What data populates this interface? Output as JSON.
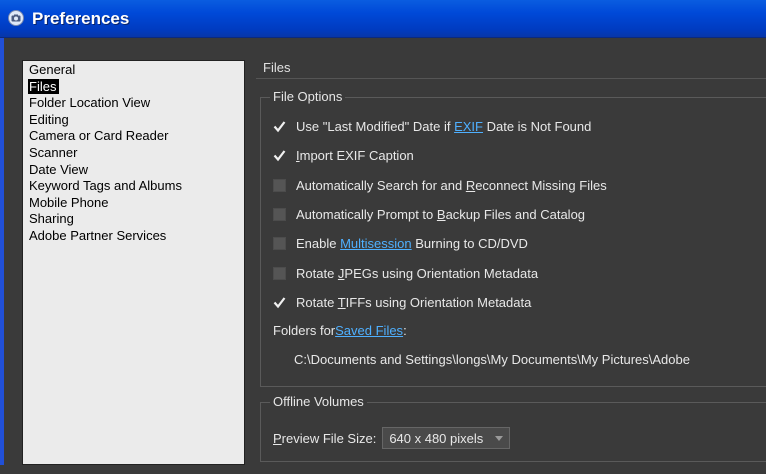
{
  "window": {
    "title": "Preferences"
  },
  "nav": {
    "items": [
      {
        "label": "General",
        "selected": false
      },
      {
        "label": "Files",
        "selected": true
      },
      {
        "label": "Folder Location View",
        "selected": false
      },
      {
        "label": "Editing",
        "selected": false
      },
      {
        "label": "Camera or Card Reader",
        "selected": false
      },
      {
        "label": "Scanner",
        "selected": false
      },
      {
        "label": "Date View",
        "selected": false
      },
      {
        "label": "Keyword Tags and Albums",
        "selected": false
      },
      {
        "label": "Mobile Phone",
        "selected": false
      },
      {
        "label": "Sharing",
        "selected": false
      },
      {
        "label": "Adobe Partner Services",
        "selected": false
      }
    ]
  },
  "section": {
    "title": "Files"
  },
  "file_options": {
    "legend": "File Options",
    "opt1": {
      "checked": true,
      "a": "Use \"Last Modified\" Date if ",
      "link": "EXIF",
      "b": " Date is Not Found"
    },
    "opt2": {
      "checked": true,
      "u": "I",
      "rest": "mport EXIF Caption"
    },
    "opt3": {
      "checked": false,
      "a": "Automatically Search for and ",
      "u": "R",
      "b": "econnect Missing Files"
    },
    "opt4": {
      "checked": false,
      "a": "Automatically Prompt to ",
      "u": "B",
      "b": "ackup Files and Catalog"
    },
    "opt5": {
      "checked": false,
      "a": "Enable ",
      "link": "Multisession",
      "b": " Burning to CD/DVD"
    },
    "opt6": {
      "checked": false,
      "a": "Rotate ",
      "u": "J",
      "b": "PEGs using Orientation Metadata"
    },
    "opt7": {
      "checked": true,
      "a": "Rotate ",
      "u": "T",
      "b": "IFFs using Orientation Metadata"
    },
    "saved_files": {
      "a": "Folders for ",
      "link": "Saved Files",
      "b": ":"
    },
    "saved_path": "C:\\Documents and Settings\\longs\\My Documents\\My Pictures\\Adobe"
  },
  "offline_volumes": {
    "legend": "Offline Volumes",
    "preview": {
      "u": "P",
      "rest": "review File Size:"
    },
    "preview_value": "640 x 480 pixels"
  },
  "colors": {
    "titlebar": "#0049d8",
    "panel": "#3a3a3a",
    "list_bg": "#ebebeb",
    "link": "#4fb0ff"
  }
}
